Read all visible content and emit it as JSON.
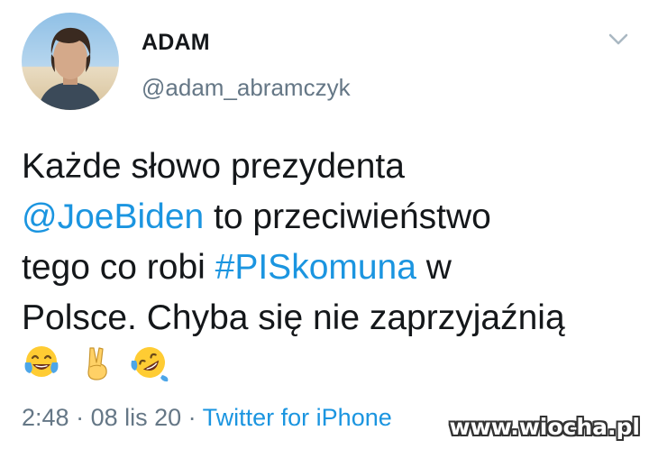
{
  "author": {
    "name": "ADAM",
    "handle": "@adam_abramczyk",
    "avatar_icon": "user-avatar"
  },
  "tweet": {
    "line1": "Każde słowo prezydenta",
    "mention": "@JoeBiden",
    "line2_rest": " to przeciwieństwo",
    "line3_start": "tego co robi ",
    "hashtag": "#PISkomuna",
    "line3_end": " w",
    "line4": "Polsce. Chyba się nie zaprzyjaźnią",
    "emojis": [
      "tears-of-joy-emoji",
      "victory-hand-emoji",
      "rolling-laughing-emoji"
    ]
  },
  "meta": {
    "time": "2:48",
    "separator": " · ",
    "date": "08 lis 20",
    "separator2": " · ",
    "source": "Twitter for iPhone"
  },
  "watermark": "www.wiocha.pl",
  "colors": {
    "link": "#1b95e0",
    "text": "#14171a",
    "muted": "#657786"
  },
  "icons": {
    "menu": "chevron-down-icon"
  }
}
